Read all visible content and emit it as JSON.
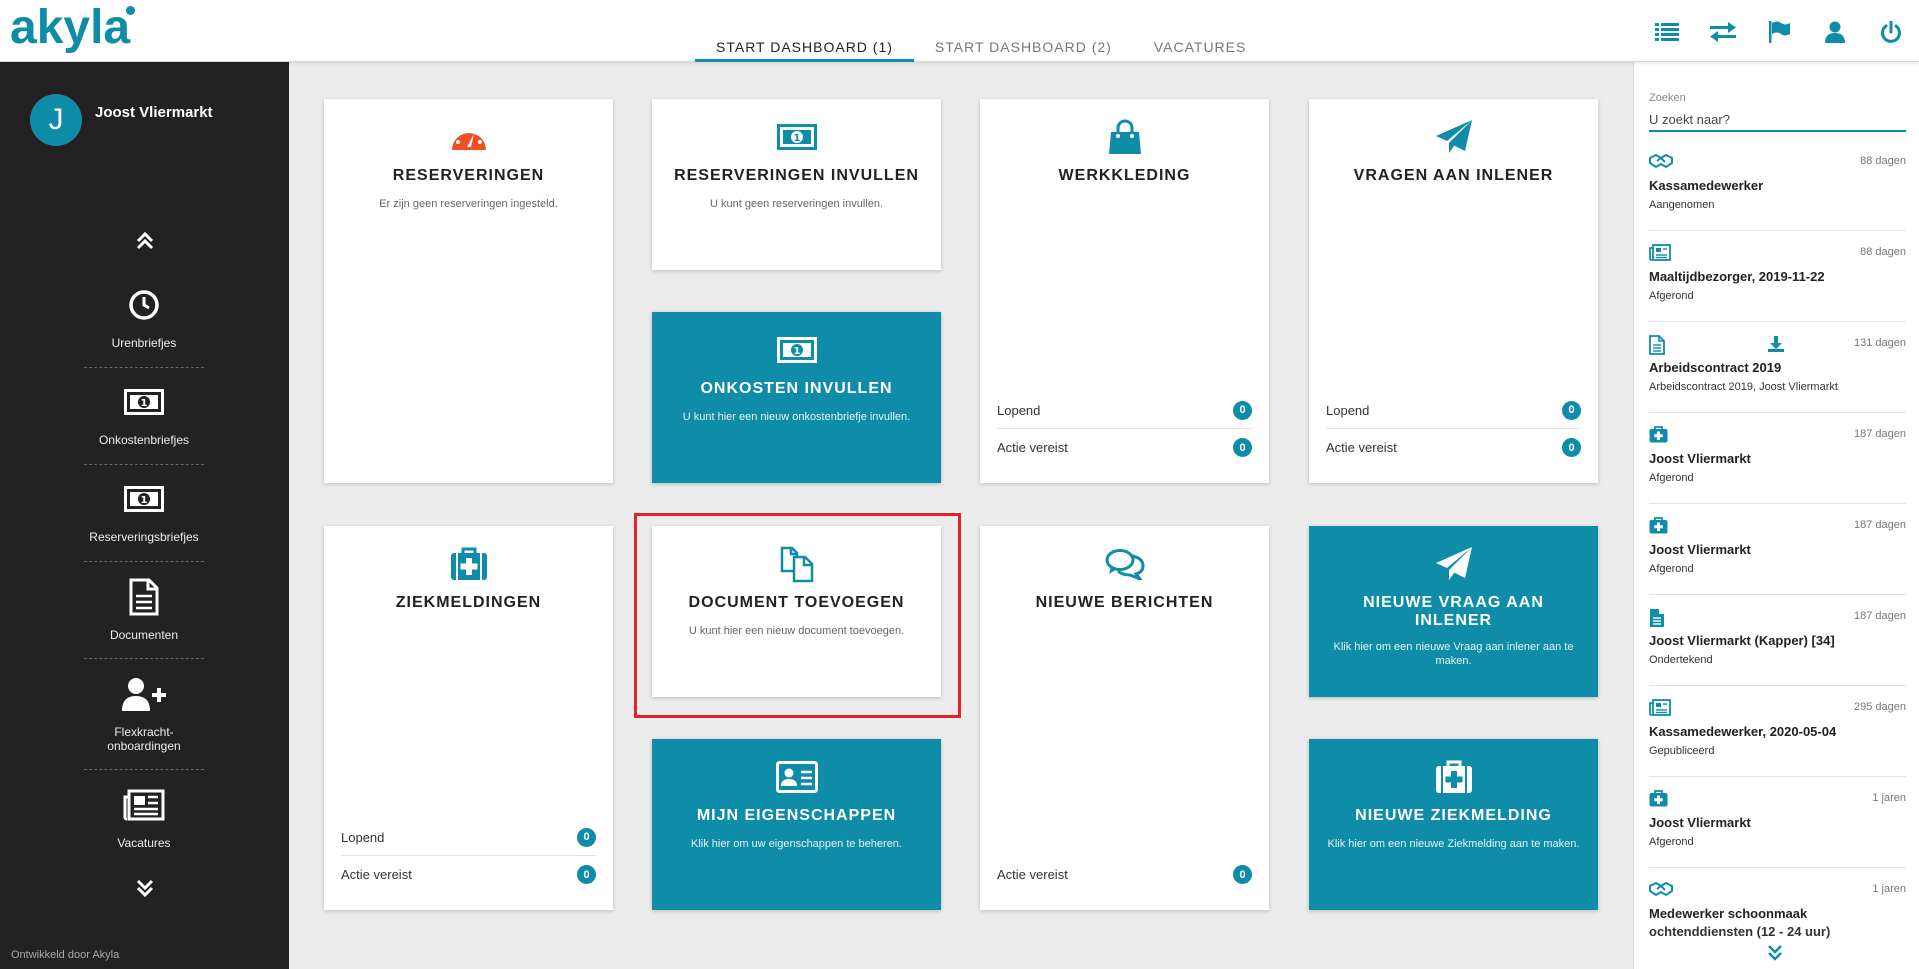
{
  "app": {
    "logo": "akyla",
    "accent": "#0f8ca8"
  },
  "header": {
    "tabs": [
      {
        "label": "START DASHBOARD (1)",
        "active": true
      },
      {
        "label": "START DASHBOARD (2)",
        "active": false
      },
      {
        "label": "VACATURES",
        "active": false
      }
    ],
    "icons": [
      "list-icon",
      "swap-arrows-icon",
      "flag-icon",
      "user-icon",
      "power-icon"
    ]
  },
  "sidebar": {
    "user_initial": "J",
    "user_name": "Joost Vliermarkt",
    "items": [
      {
        "label": "Urenbriefjes",
        "icon": "clock-icon"
      },
      {
        "label": "Onkostenbriefjes",
        "icon": "banknote-icon"
      },
      {
        "label": "Reserveringsbriefjes",
        "icon": "banknote-icon"
      },
      {
        "label": "Documenten",
        "icon": "document-icon"
      },
      {
        "label": "Flexkracht-onboardingen",
        "icon": "user-plus-icon"
      },
      {
        "label": "Vacatures",
        "icon": "newspaper-icon"
      }
    ],
    "credit": "Ontwikkeld door Akyla"
  },
  "tiles": {
    "reserveringen": {
      "title": "RESERVERINGEN",
      "desc": "Er zijn geen reserveringen ingesteld."
    },
    "reserveringen_invullen": {
      "title": "RESERVERINGEN INVULLEN",
      "desc": "U kunt geen reserveringen invullen."
    },
    "werkkleding": {
      "title": "WERKKLEDING",
      "lopend_label": "Lopend",
      "lopend_count": "0",
      "actie_label": "Actie vereist",
      "actie_count": "0"
    },
    "vragen_aan_inlener": {
      "title": "VRAGEN AAN INLENER",
      "lopend_label": "Lopend",
      "lopend_count": "0",
      "actie_label": "Actie vereist",
      "actie_count": "0"
    },
    "onkosten_invullen": {
      "title": "ONKOSTEN INVULLEN",
      "desc": "U kunt hier een nieuw onkostenbriefje invullen."
    },
    "ziekmeldingen": {
      "title": "ZIEKMELDINGEN",
      "lopend_label": "Lopend",
      "lopend_count": "0",
      "actie_label": "Actie vereist",
      "actie_count": "0"
    },
    "document_toevoegen": {
      "title": "DOCUMENT TOEVOEGEN",
      "desc": "U kunt hier een nieuw document toevoegen."
    },
    "nieuwe_berichten": {
      "title": "NIEUWE BERICHTEN",
      "actie_label": "Actie vereist",
      "actie_count": "0"
    },
    "nieuwe_vraag": {
      "title": "NIEUWE VRAAG AAN INLENER",
      "desc": "Klik hier om een nieuwe Vraag aan inlener aan te maken."
    },
    "mijn_eigenschappen": {
      "title": "MIJN EIGENSCHAPPEN",
      "desc": "Klik hier om uw eigenschappen te beheren."
    },
    "nieuwe_ziekmelding": {
      "title": "NIEUWE ZIEKMELDING",
      "desc": "Klik hier om een nieuwe Ziekmelding aan te maken."
    }
  },
  "panel": {
    "search_label": "Zoeken",
    "search_placeholder": "U zoekt naar?",
    "items": [
      {
        "icon": "handshake-icon",
        "age": "88 dagen",
        "title": "Kassamedewerker",
        "sub": "Aangenomen"
      },
      {
        "icon": "newspaper-icon",
        "age": "88 dagen",
        "title": "Maaltijdbezorger, 2019-11-22",
        "sub": "Afgerond"
      },
      {
        "icon": "document-icon",
        "icon2": "download-icon",
        "age": "131 dagen",
        "title": "Arbeidscontract 2019",
        "sub": "Arbeidscontract 2019, Joost Vliermarkt"
      },
      {
        "icon": "medkit-icon",
        "age": "187 dagen",
        "title": "Joost Vliermarkt",
        "sub": "Afgerond"
      },
      {
        "icon": "medkit-icon",
        "age": "187 dagen",
        "title": "Joost Vliermarkt",
        "sub": "Afgerond"
      },
      {
        "icon": "document-filled-icon",
        "age": "187 dagen",
        "title": "Joost Vliermarkt (Kapper) [34]",
        "sub": "Ondertekend"
      },
      {
        "icon": "newspaper-icon",
        "age": "295 dagen",
        "title": "Kassamedewerker, 2020-05-04",
        "sub": "Gepubliceerd"
      },
      {
        "icon": "medkit-icon",
        "age": "1 jaren",
        "title": "Joost Vliermarkt",
        "sub": "Afgerond"
      },
      {
        "icon": "handshake-icon",
        "age": "1 jaren",
        "title": "Medewerker schoonmaak",
        "sub": "ochtenddiensten (12 - 24 uur)"
      }
    ]
  }
}
